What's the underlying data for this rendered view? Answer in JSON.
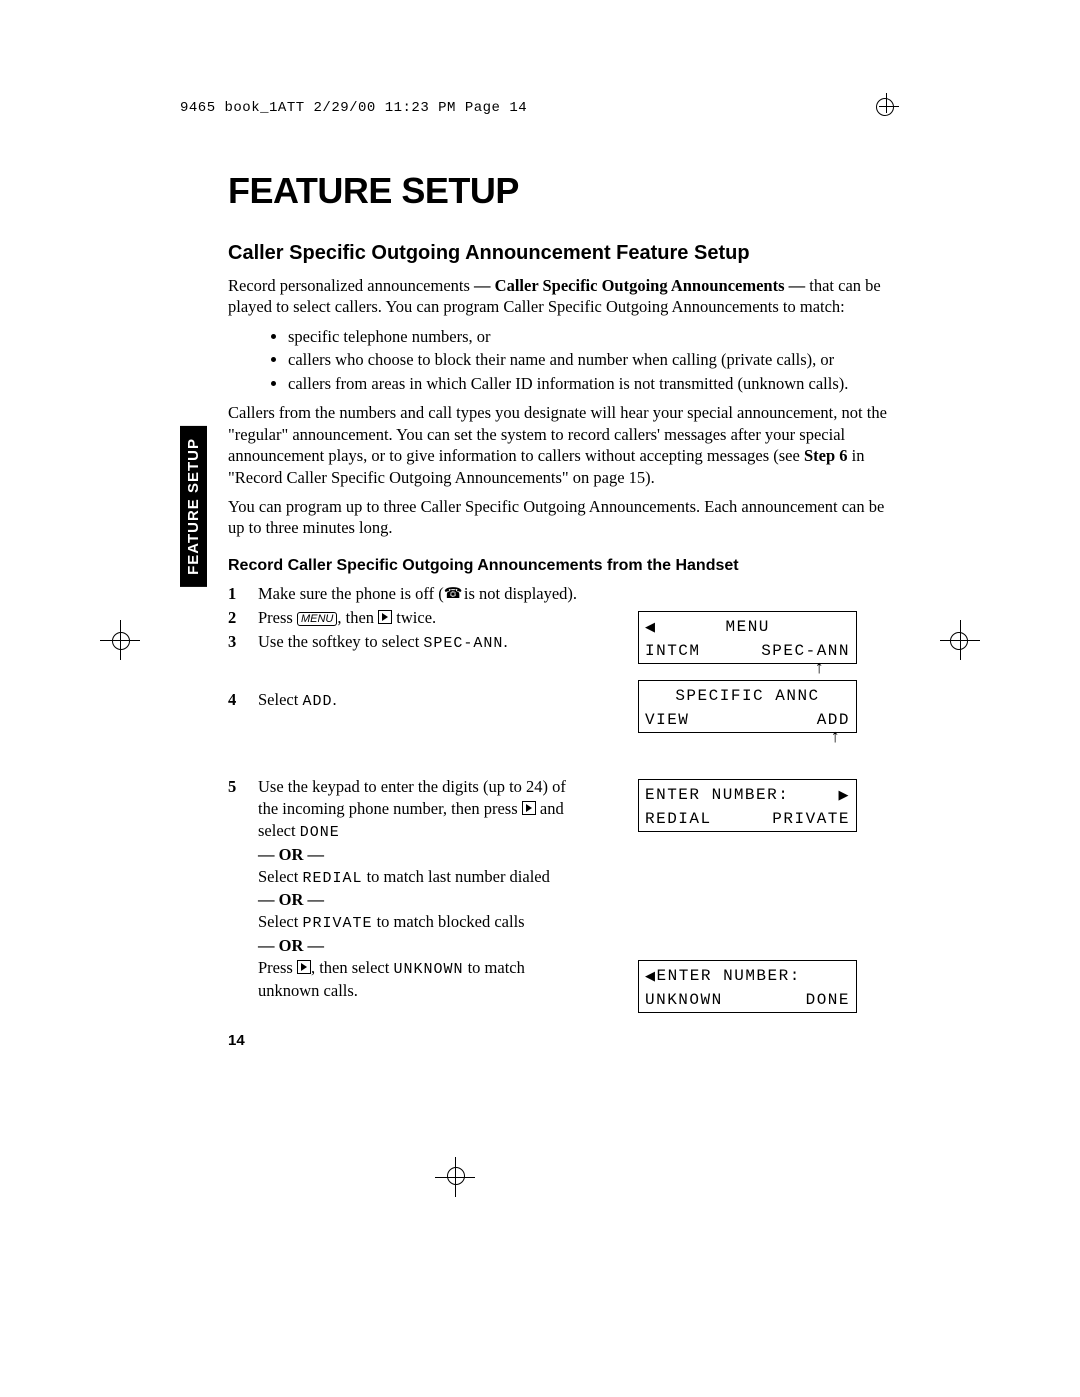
{
  "header_line": "9465 book_1ATT  2/29/00  11:23 PM  Page 14",
  "title": "FEATURE SETUP",
  "section_title": "Caller Specific Outgoing Announcement Feature Setup",
  "side_tab": "FEATURE SETUP",
  "intro_pre": "Record personalized announcements ",
  "intro_bold": "— Caller Specific Outgoing Announcements —",
  "intro_post": " that can be played to select callers. You can program Caller Specific Outgoing Announcements to match:",
  "bullets": [
    "specific telephone numbers, or",
    "callers who choose to block their name and number when calling (private calls), or",
    "callers from areas in which Caller ID information is not transmitted (unknown calls)."
  ],
  "para2_a": "Callers from the numbers and call types you designate will hear your special announcement, not the \"regular\" announcement.  You can set the system to record callers' messages after your special announcement plays, or to give information to callers without accepting messages (see ",
  "para2_bold": "Step 6",
  "para2_b": " in \"Record Caller Specific Outgoing Announcements\" on page 15).",
  "para3": "You can program up to three Caller Specific Outgoing Announcements. Each announcement can be up to three minutes long.",
  "subheading": "Record Caller Specific Outgoing Announcements from the Handset",
  "steps": {
    "s1_a": "Make sure the phone is off (",
    "s1_b": " is not displayed).",
    "s2_a": "Press ",
    "s2_menu": "MENU",
    "s2_b": ", then ",
    "s2_c": " twice.",
    "s3_a": "Use the softkey to select ",
    "s3_code": "SPEC-ANN",
    "s3_b": ".",
    "s4_a": "Select ",
    "s4_code": "ADD",
    "s4_b": ".",
    "s5_a": "Use the keypad to enter the digits (up to 24) of the incoming phone number, then press ",
    "s5_b": " and select ",
    "s5_code1": "DONE",
    "or": "— OR —",
    "s5_c": "Select ",
    "s5_code2": "REDIAL",
    "s5_d": " to match last number dialed",
    "s5_e": "Select ",
    "s5_code3": "PRIVATE",
    "s5_f": " to match blocked calls",
    "s5_g": "Press ",
    "s5_h": ", then select ",
    "s5_code4": "UNKNOWN",
    "s5_i": " to match unknown calls."
  },
  "screens": {
    "scr1_top_center": "MENU",
    "scr1_bot_left": "INTCM",
    "scr1_bot_right": "SPEC-ANN",
    "scr2_top": "SPECIFIC ANNC",
    "scr2_bot_left": "VIEW",
    "scr2_bot_right": "ADD",
    "scr3_top": "ENTER NUMBER:",
    "scr3_bot_left": "REDIAL",
    "scr3_bot_right": "PRIVATE",
    "scr4_top": "ENTER NUMBER:",
    "scr4_bot_left": "UNKNOWN",
    "scr4_bot_right": "DONE"
  },
  "page_number": "14"
}
